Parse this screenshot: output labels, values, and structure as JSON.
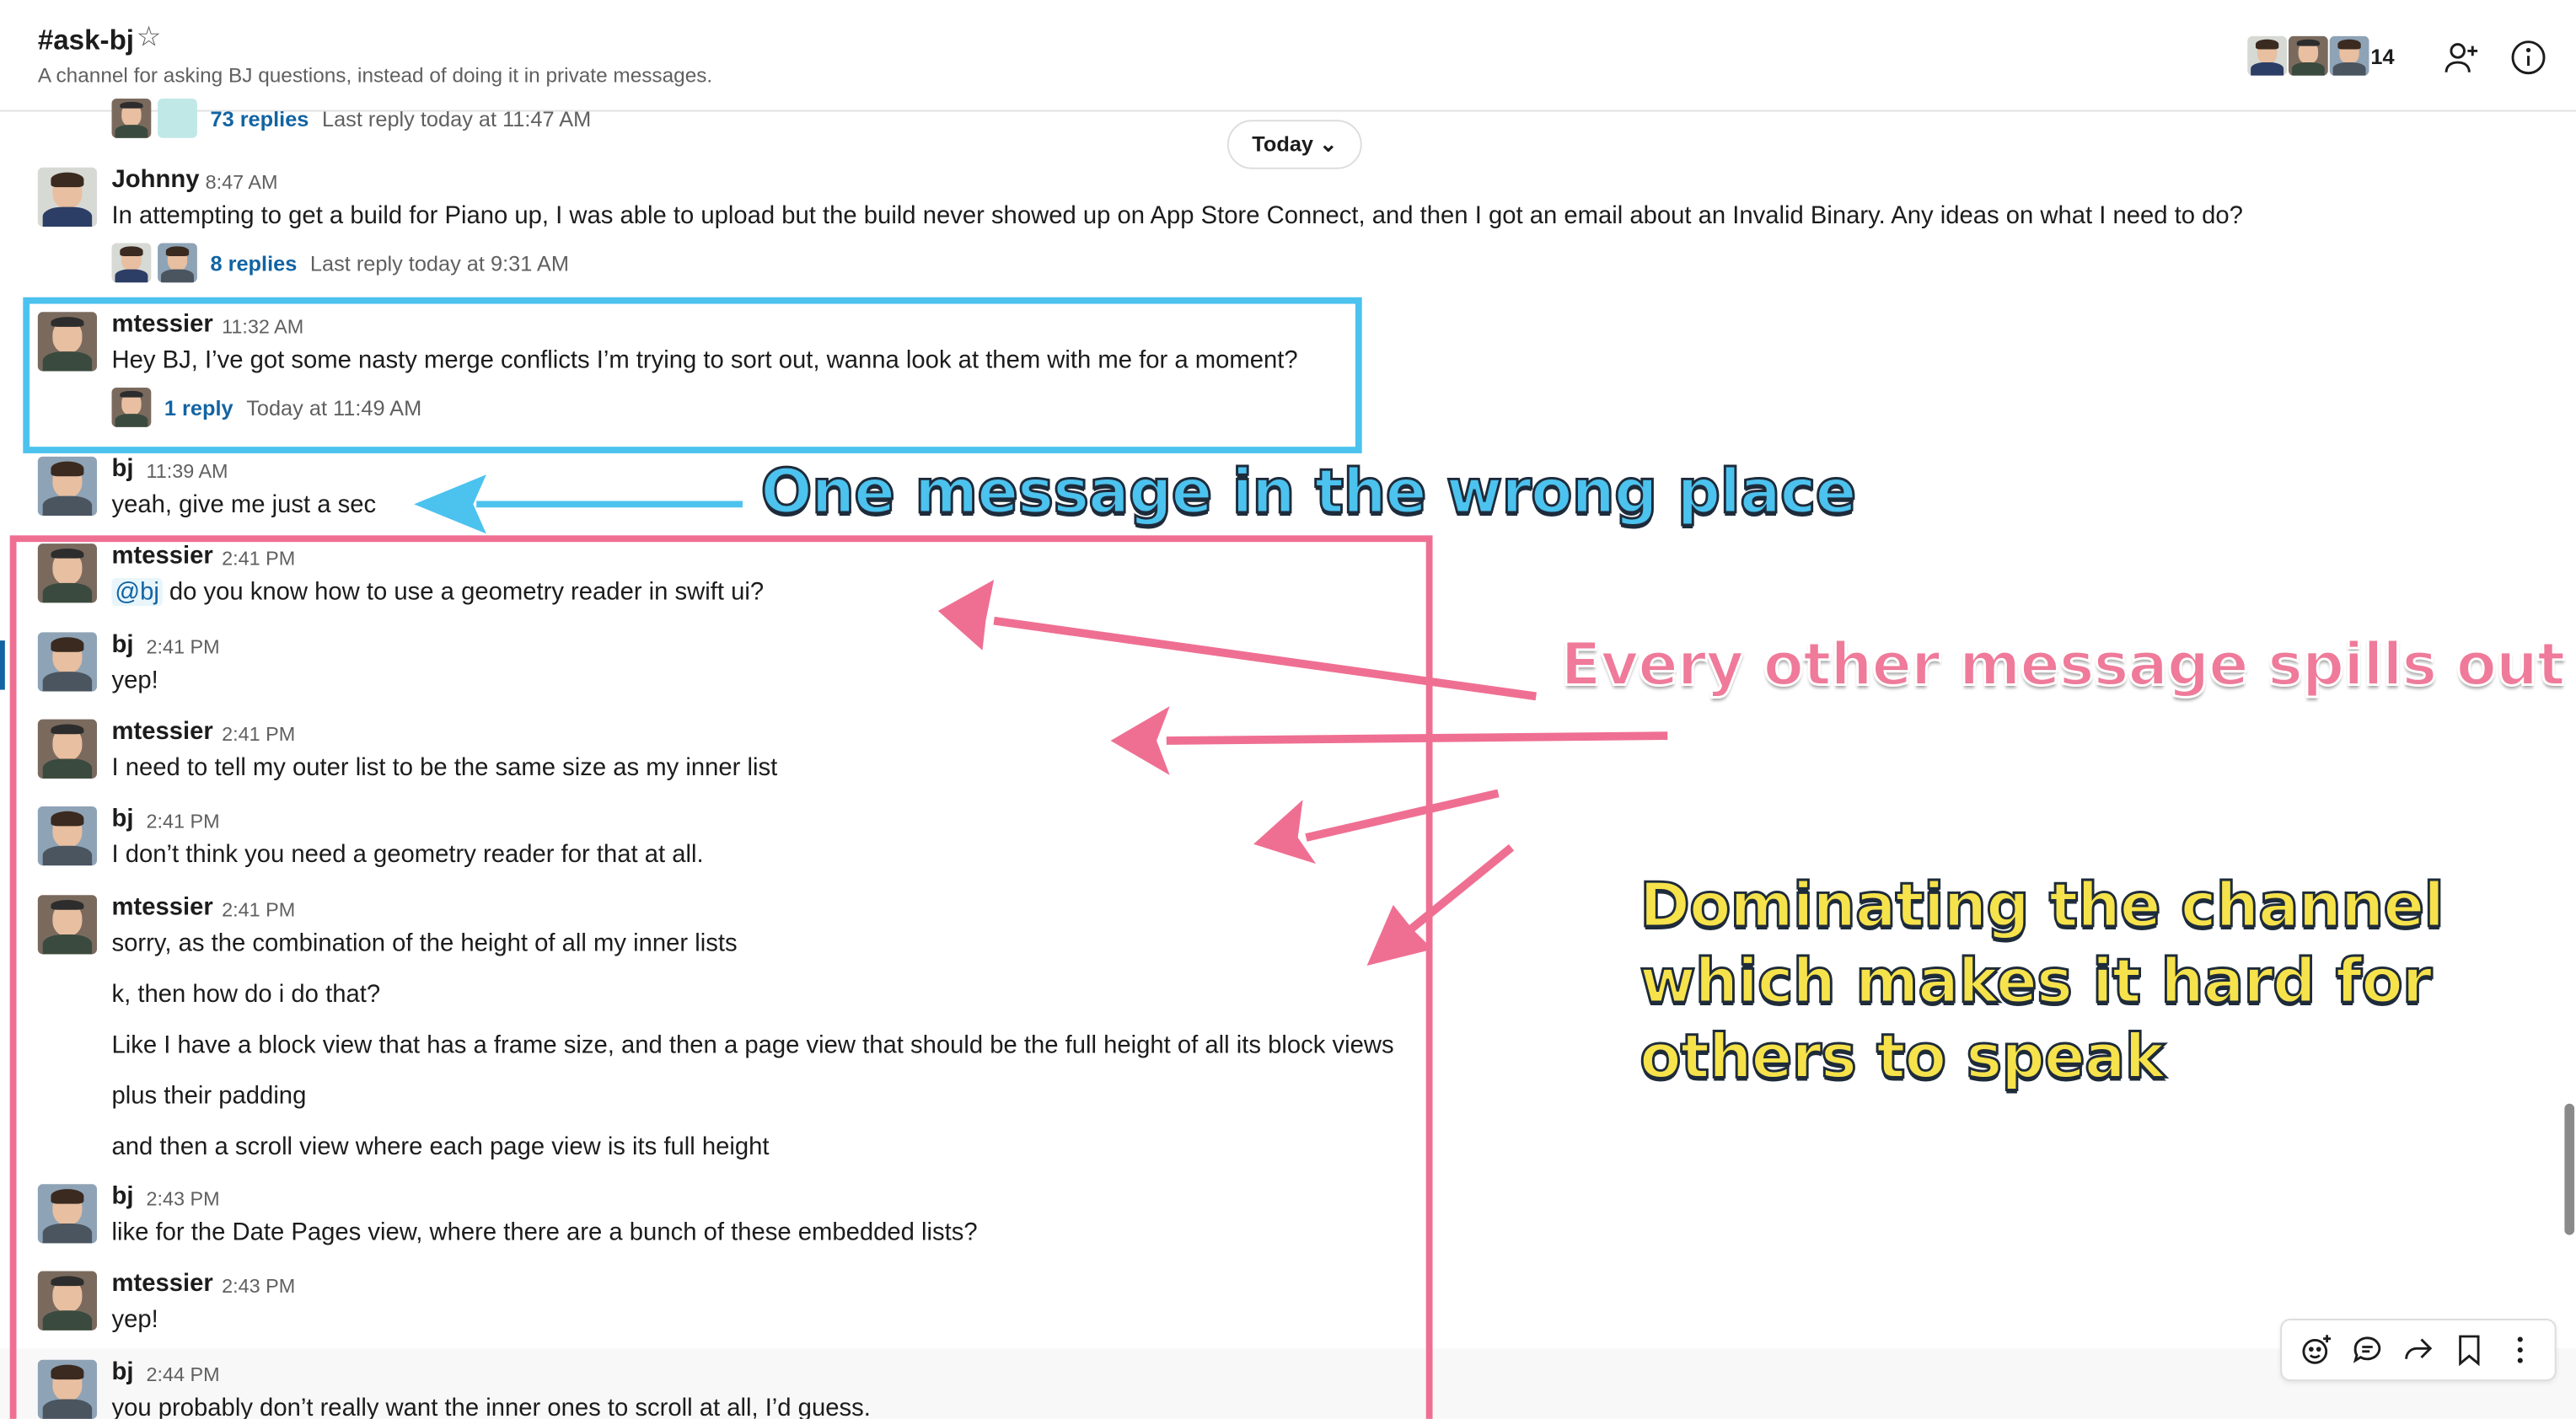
{
  "channel": {
    "name": "#ask-bj",
    "topic": "A channel for asking BJ questions, instead of doing it in private messages.",
    "member_count": "14"
  },
  "date_divider": "Today",
  "prior_thread": {
    "replies": "73 replies",
    "last_reply": "Last reply today at 11:47 AM"
  },
  "messages": [
    {
      "author": "Johnny",
      "time": "8:47 AM",
      "text": "In attempting to get a build for Piano up, I was able to upload but the build never showed up on App Store Connect, and then I got an email about an Invalid Binary. Any ideas on what I need to do?",
      "thread_replies": "8 replies",
      "thread_last": "Last reply today at 9:31 AM"
    },
    {
      "author": "mtessier",
      "time": "11:32 AM",
      "text": "Hey BJ, I’ve got some nasty merge conflicts I’m trying to sort out, wanna look at them with me for a moment?",
      "thread_replies": "1 reply",
      "thread_last": "Today at 11:49 AM"
    },
    {
      "author": "bj",
      "time": "11:39 AM",
      "text": "yeah, give me just a sec"
    },
    {
      "author": "mtessier",
      "time": "2:41 PM",
      "mention": "@bj",
      "text": "do you know how to use a geometry reader in swift ui?"
    },
    {
      "author": "bj",
      "time": "2:41 PM",
      "text": "yep!"
    },
    {
      "author": "mtessier",
      "time": "2:41 PM",
      "text": "I need to tell my outer list to be the same size as my inner list"
    },
    {
      "author": "bj",
      "time": "2:41 PM",
      "text": "I don’t think you need a geometry reader for that at all."
    },
    {
      "author": "mtessier",
      "time": "2:41 PM",
      "text": "sorry, as the combination of the height of all my inner lists"
    },
    {
      "text": "k, then how do i do that?"
    },
    {
      "text": "Like I have a block view that has a frame size, and then a page view that should be the full height of all its block views"
    },
    {
      "text": "plus their padding"
    },
    {
      "text": "and then a scroll view where each page view is its full height"
    },
    {
      "author": "bj",
      "time": "2:43 PM",
      "text": "like for the Date Pages view, where there are a bunch of these embedded lists?"
    },
    {
      "author": "mtessier",
      "time": "2:43 PM",
      "text": "yep!"
    },
    {
      "author": "bj",
      "time": "2:44 PM",
      "text": "you probably don’t really want the inner ones to scroll at all, I’d guess."
    }
  ],
  "annotations": {
    "blue": "One message in the wrong place",
    "pink": "Every other message spills out",
    "yellow": [
      "Dominating the channel",
      "which makes it hard for",
      "others to speak"
    ]
  },
  "colors": {
    "blue_annotation": "#4cc2ee",
    "pink_annotation": "#ef6f92",
    "yellow_annotation": "#f6e24b",
    "link": "#1264a3"
  }
}
